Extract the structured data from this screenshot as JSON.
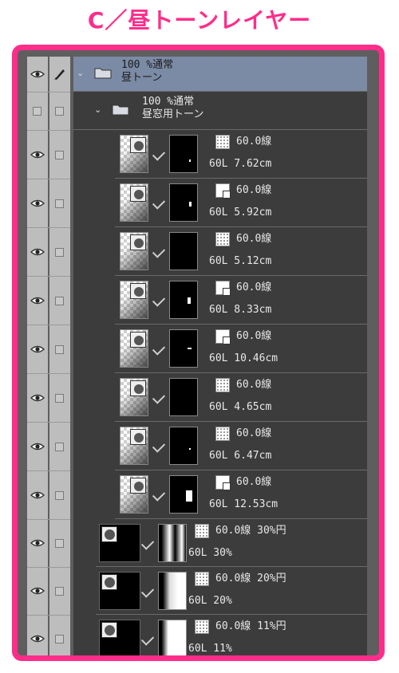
{
  "title": "C／昼トーンレイヤー",
  "folders": [
    {
      "line1": "100 %通常",
      "line2": "昼トーン"
    },
    {
      "line1": "100 %通常",
      "line2": "昼窓用トーン"
    }
  ],
  "layers": [
    {
      "tone": "60.0線",
      "info": "60L 7.62cm"
    },
    {
      "tone": "60.0線",
      "info": "60L 5.92cm"
    },
    {
      "tone": "60.0線",
      "info": "60L 5.12cm"
    },
    {
      "tone": "60.0線",
      "info": "60L 8.33cm"
    },
    {
      "tone": "60.0線",
      "info": "60L 10.46cm"
    },
    {
      "tone": "60.0線",
      "info": "60L 4.65cm"
    },
    {
      "tone": "60.0線",
      "info": "60L 6.47cm"
    },
    {
      "tone": "60.0線",
      "info": "60L 12.53cm"
    }
  ],
  "bottom_layers": [
    {
      "tone": "60.0線 30%円",
      "info": "60L 30%"
    },
    {
      "tone": "60.0線 20%円",
      "info": "60L 20%"
    },
    {
      "tone": "60.0線 11%円",
      "info": "60L 11%"
    }
  ],
  "colors": {
    "accent": "#ff2d8a",
    "selected_row": "#7b8aa5",
    "panel": "#3c3c3c"
  }
}
